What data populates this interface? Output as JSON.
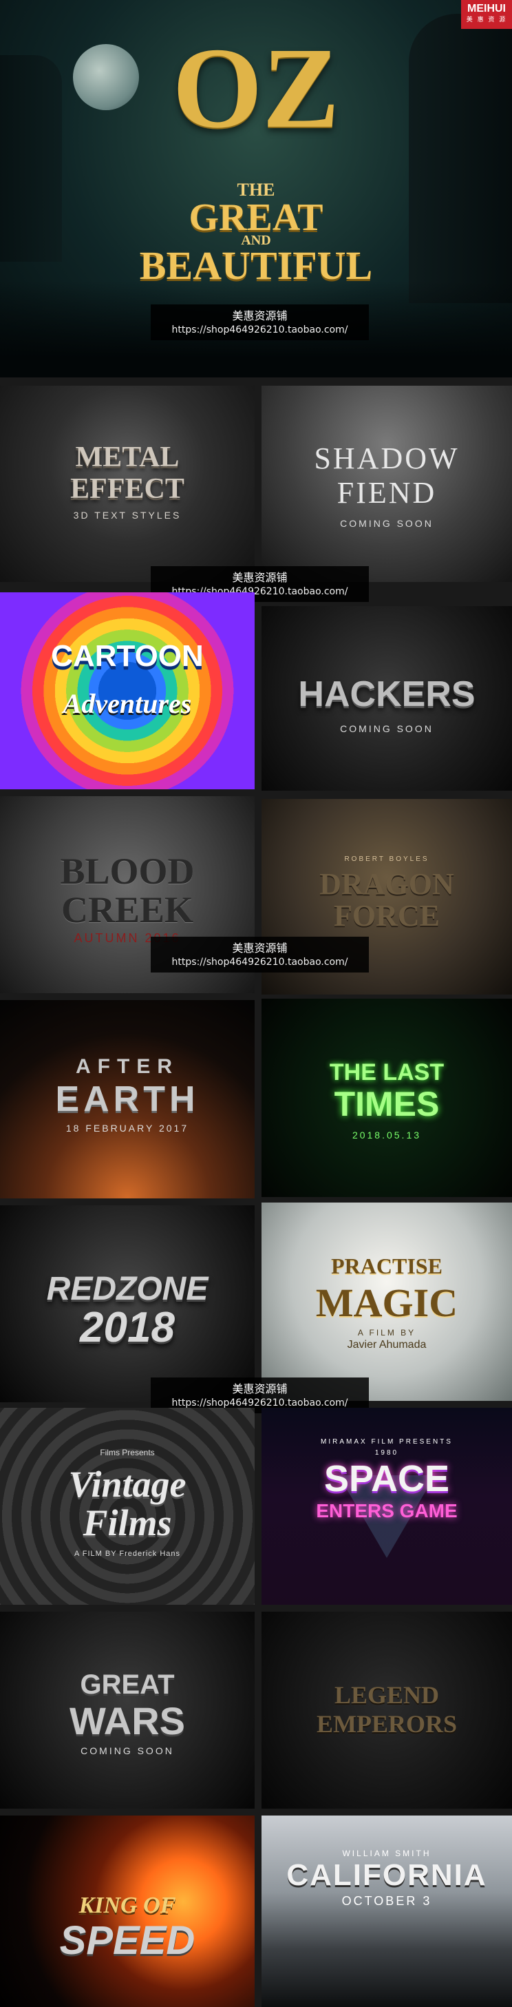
{
  "brand": {
    "top": "MEIHUI",
    "bottom": "美 惠 资 源"
  },
  "watermark": {
    "shop_name": "美惠资源铺",
    "url": "https://shop464926210.taobao.com/"
  },
  "hero": {
    "title_top": "OZ",
    "title_the": "THE",
    "title_great": "GREAT",
    "title_and": "AND",
    "title_beautiful": "BEAUTIFUL"
  },
  "tiles": [
    {
      "line1": "METAL",
      "line2": "EFFECT",
      "line3": "3D TEXT STYLES",
      "line4": ""
    },
    {
      "line1": "SHADOW",
      "line2": "FIEND",
      "line3": "COMING SOON",
      "line4": ""
    },
    {
      "line1": "CARTOON",
      "line2": "Adventures",
      "line3": "",
      "line4": ""
    },
    {
      "line1": "HACKERS",
      "line2": "",
      "line3": "COMING SOON",
      "line4": ""
    },
    {
      "line1": "BLOOD",
      "line2": "CREEK",
      "line3": "AUTUMN 2016",
      "line4": ""
    },
    {
      "line1": "ROBERT BOYLES",
      "line2": "DRAGON",
      "line3": "FORCE",
      "line4": ""
    },
    {
      "line1": "AFTER",
      "line2": "EARTH",
      "line3": "18 FEBRUARY 2017",
      "line4": ""
    },
    {
      "line1": "THE LAST",
      "line2": "TIMES",
      "line3": "2018.05.13",
      "line4": ""
    },
    {
      "line1": "REDZONE",
      "line2": "2018",
      "line3": "",
      "line4": ""
    },
    {
      "line1": "PRACTISE",
      "line2": "MAGIC",
      "line3": "A FILM BY",
      "line4": "Javier Ahumada"
    },
    {
      "line1": "Films Presents",
      "line2": "Vintage",
      "line3": "Films",
      "line4": "A FILM BY Frederick Hans"
    },
    {
      "line1": "MIRAMAX FILM PRESENTS",
      "line2": "SPACE",
      "line3": "ENTERS GAME",
      "line4": "1980"
    },
    {
      "line1": "GREAT",
      "line2": "WARS",
      "line3": "COMING SOON",
      "line4": ""
    },
    {
      "line1": "LEGEND",
      "line2": "EMPERORS",
      "line3": "",
      "line4": ""
    },
    {
      "line1": "KING OF",
      "line2": "SPEED",
      "line3": "",
      "line4": ""
    },
    {
      "line1": "WILLIAM SMITH",
      "line2": "CALIFORNIA",
      "line3": "OCTOBER 3",
      "line4": ""
    }
  ],
  "colors": {
    "brand_red": "#c9202a",
    "gold": "#e0b448"
  }
}
